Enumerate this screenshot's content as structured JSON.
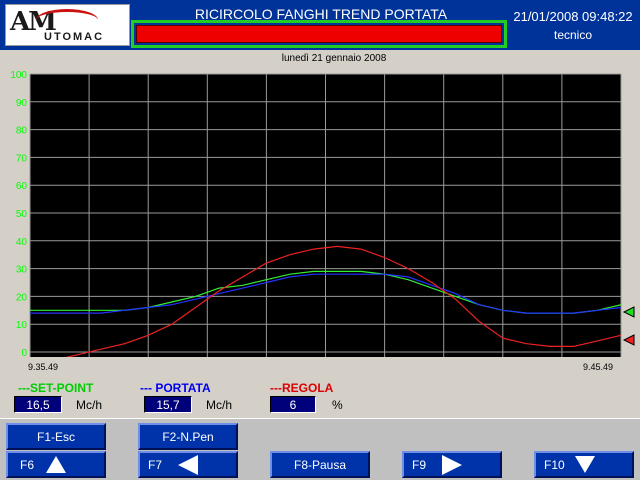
{
  "header": {
    "title": "RICIRCOLO FANGHI  TREND PORTATA",
    "logo_main": "AM",
    "logo_sub": "UTOMAC",
    "datetime": "21/01/2008 09:48:22",
    "user": "tecnico",
    "alarm_color": "#ee0000"
  },
  "chart_data": {
    "type": "line",
    "title": "lunedì 21 gennaio 2008",
    "x_start_label": "9.35.49",
    "x_end_label": "9.45.49",
    "ylim": [
      0,
      100
    ],
    "yticks": [
      0,
      10,
      20,
      30,
      40,
      50,
      60,
      70,
      80,
      90,
      100
    ],
    "grid": true,
    "background": "#000000",
    "series": [
      {
        "name": "SET-POINT",
        "color": "#33ee33",
        "values": [
          15,
          15,
          15,
          15,
          15,
          16,
          18,
          20,
          23,
          24,
          26,
          28,
          29,
          29,
          29,
          28,
          26,
          23,
          20,
          17,
          15,
          14,
          14,
          14,
          15,
          17
        ]
      },
      {
        "name": "PORTATA",
        "color": "#2233ff",
        "values": [
          14,
          14,
          14,
          14,
          15,
          16,
          17,
          19,
          21,
          23,
          25,
          27,
          28,
          28,
          28,
          28,
          27,
          24,
          21,
          17,
          15,
          14,
          14,
          14,
          15,
          16
        ]
      },
      {
        "name": "REGOLA",
        "color": "#ee2222",
        "values": [
          -5,
          -3,
          -1,
          1,
          3,
          6,
          10,
          16,
          22,
          27,
          32,
          35,
          37,
          38,
          37,
          34,
          30,
          25,
          19,
          11,
          5,
          3,
          2,
          2,
          4,
          6
        ]
      }
    ]
  },
  "readouts": [
    {
      "name": "---SET-POINT",
      "color": "#00cc00",
      "value": "16,5",
      "unit": "Mc/h"
    },
    {
      "name": "--- PORTATA",
      "color": "#0000ee",
      "value": "15,7",
      "unit": "Mc/h"
    },
    {
      "name": "---REGOLA",
      "color": "#dd0000",
      "value": "6",
      "unit": "%"
    }
  ],
  "fkeys": {
    "f1": "F1-Esc",
    "f2": "F2-N.Pen",
    "f6": "F6",
    "f7": "F7",
    "f8": "F8-Pausa",
    "f9": "F9",
    "f10": "F10"
  }
}
